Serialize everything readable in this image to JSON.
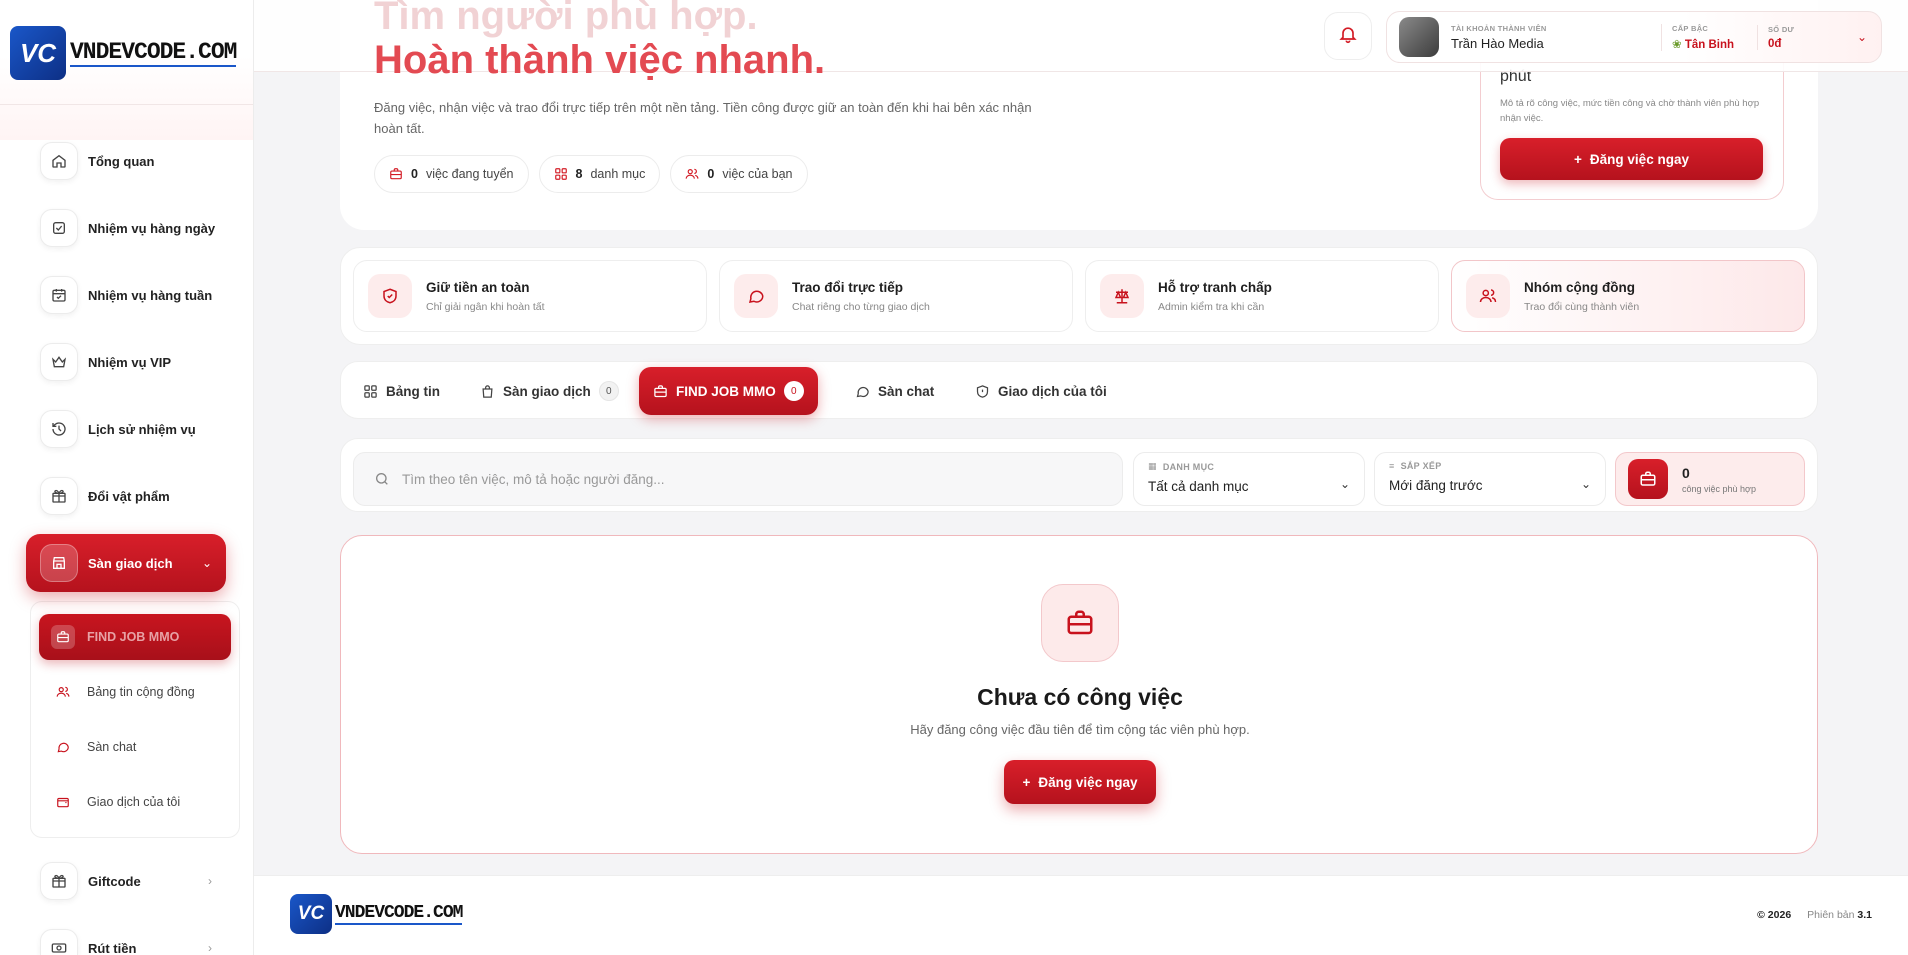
{
  "brand": {
    "name": "VNDEVCODE.COM",
    "mark": "VC"
  },
  "sidebar": {
    "items": [
      {
        "label": "Tổng quan",
        "icon": "home-icon"
      },
      {
        "label": "Nhiệm vụ hàng ngày",
        "icon": "checkbox-icon"
      },
      {
        "label": "Nhiệm vụ hàng tuần",
        "icon": "calendar-check-icon"
      },
      {
        "label": "Nhiệm vụ VIP",
        "icon": "crown-icon"
      },
      {
        "label": "Lịch sử nhiệm vụ",
        "icon": "history-icon"
      },
      {
        "label": "Đổi vật phẩm",
        "icon": "gift-icon"
      },
      {
        "label": "Sàn giao dịch",
        "icon": "store-icon"
      }
    ],
    "submenu": [
      {
        "label": "FIND JOB MMO",
        "icon": "briefcase-icon"
      },
      {
        "label": "Bảng tin cộng đồng",
        "icon": "users-icon"
      },
      {
        "label": "Sàn chat",
        "icon": "chat-icon"
      },
      {
        "label": "Giao dịch của tôi",
        "icon": "wallet-icon"
      }
    ],
    "after": [
      {
        "label": "Giftcode",
        "icon": "gift-icon"
      },
      {
        "label": "Rút tiền",
        "icon": "money-icon"
      }
    ]
  },
  "header": {
    "hero_line1": "Tìm người phù hợp.",
    "hero_line2": "Hoàn thành việc nhanh.",
    "account_label": "TÀI KHOẢN THÀNH VIÊN",
    "account_name": "Trần Hào Media",
    "rank_label": "CẤP BẬC",
    "rank_value": "Tân Binh",
    "balance_label": "SỐ DƯ",
    "balance_value": "0đ"
  },
  "hero": {
    "description": "Đăng việc, nhận việc và trao đổi trực tiếp trên một nền tảng. Tiền công được giữ an toàn đến khi hai bên xác nhận hoàn tất.",
    "stats": [
      {
        "num": "0",
        "label": "việc đang tuyển",
        "icon": "briefcase-icon"
      },
      {
        "num": "8",
        "label": "danh mục",
        "icon": "grid-icon"
      },
      {
        "num": "0",
        "label": "việc của bạn",
        "icon": "users-icon"
      }
    ],
    "post_title": "phút",
    "post_desc": "Mô tả rõ công việc, mức tiền công và chờ thành viên phù hợp nhận việc.",
    "post_button": "Đăng việc ngay"
  },
  "features": [
    {
      "title": "Giữ tiền an toàn",
      "sub": "Chỉ giải ngân khi hoàn tất",
      "icon": "shield-check-icon"
    },
    {
      "title": "Trao đổi trực tiếp",
      "sub": "Chat riêng cho từng giao dịch",
      "icon": "chat-icon"
    },
    {
      "title": "Hỗ trợ tranh chấp",
      "sub": "Admin kiểm tra khi cần",
      "icon": "scale-icon"
    },
    {
      "title": "Nhóm cộng đồng",
      "sub": "Trao đổi cùng thành viên",
      "icon": "users-icon"
    }
  ],
  "tabs": [
    {
      "label": "Bảng tin",
      "icon": "grid-icon"
    },
    {
      "label": "Sàn giao dịch",
      "icon": "bag-icon",
      "count": "0"
    },
    {
      "label": "FIND JOB MMO",
      "icon": "briefcase-icon",
      "count": "0"
    },
    {
      "label": "Sàn chat",
      "icon": "chat-icon"
    },
    {
      "label": "Giao dịch của tôi",
      "icon": "shield-icon"
    }
  ],
  "filters": {
    "search_placeholder": "Tìm theo tên việc, mô tả hoặc người đăng...",
    "category_label": "DANH MỤC",
    "category_value": "Tất cả danh mục",
    "sort_label": "SẮP XẾP",
    "sort_value": "Mới đăng trước",
    "match_count": "0",
    "match_label": "công việc phù hợp"
  },
  "empty": {
    "title": "Chưa có công việc",
    "subtitle": "Hãy đăng công việc đầu tiên để tìm cộng tác viên phù hợp.",
    "button": "Đăng việc ngay"
  },
  "footer": {
    "year": "© 2026",
    "version_label": "Phiên bản",
    "version": "3.1"
  },
  "colors": {
    "accent": "#c8121d",
    "accent_light": "#fdecec"
  }
}
